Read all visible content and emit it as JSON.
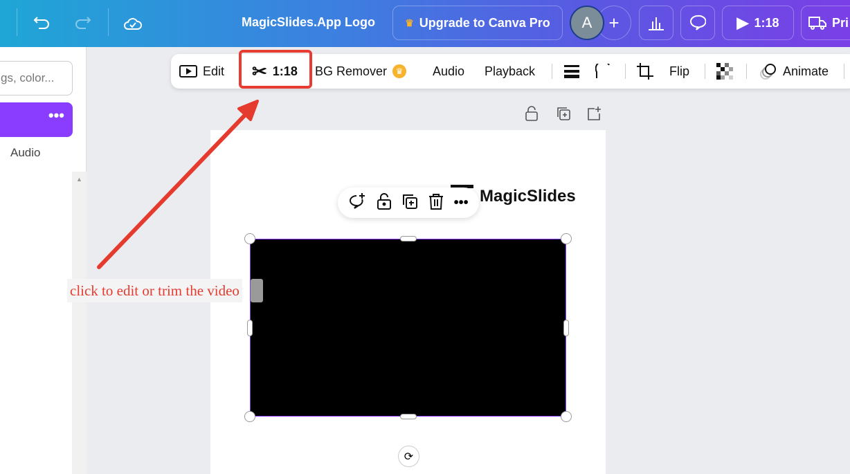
{
  "header": {
    "title": "MagicSlides.App Logo",
    "upgrade_label": "Upgrade to Canva Pro",
    "avatar_letter": "A",
    "play_time": "1:18",
    "print_label": "Pri"
  },
  "left_panel": {
    "search_placeholder": "gs, color...",
    "more_label": "•••",
    "audio_label": "Audio"
  },
  "toolbar": {
    "edit": "Edit",
    "trim_time": "1:18",
    "bg_remover": "BG Remover",
    "audio": "Audio",
    "playback": "Playback",
    "flip": "Flip",
    "animate": "Animate"
  },
  "canvas": {
    "logo_text": "MagicSlides",
    "annotation": "click to edit or trim the video"
  },
  "colors": {
    "accent": "#8b3dff",
    "annotation_red": "#e53b2f"
  }
}
